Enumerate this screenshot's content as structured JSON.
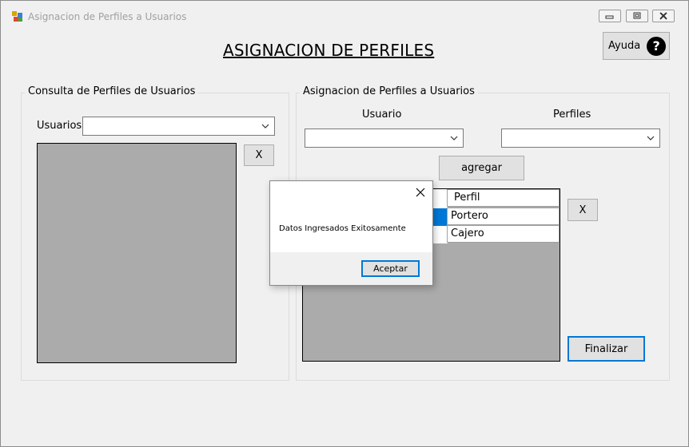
{
  "window": {
    "title": "Asignacion de Perfiles a Usuarios"
  },
  "heading": "ASIGNACION DE PERFILES",
  "help": {
    "label": "Ayuda",
    "icon_glyph": "?"
  },
  "left_group": {
    "title": "Consulta de Perfiles de Usuarios",
    "usuarios_label": "Usuarios",
    "usuarios_value": "",
    "remove_label": "X"
  },
  "right_group": {
    "title": "Asignacion de Perfiles a Usuarios",
    "usuario_label": "Usuario",
    "perfiles_label": "Perfiles",
    "usuario_value": "",
    "perfiles_value": "",
    "add_label": "agregar",
    "remove_label": "X",
    "finish_label": "Finalizar",
    "grid": {
      "column_header": "Perfil",
      "rows": [
        "Portero",
        "Cajero"
      ]
    }
  },
  "dialog": {
    "message": "Datos Ingresados Exitosamente",
    "ok_label": "Aceptar"
  },
  "colors": {
    "accent": "#0078d7",
    "panel_gray": "#ababab",
    "window_bg": "#f0f0f0"
  }
}
